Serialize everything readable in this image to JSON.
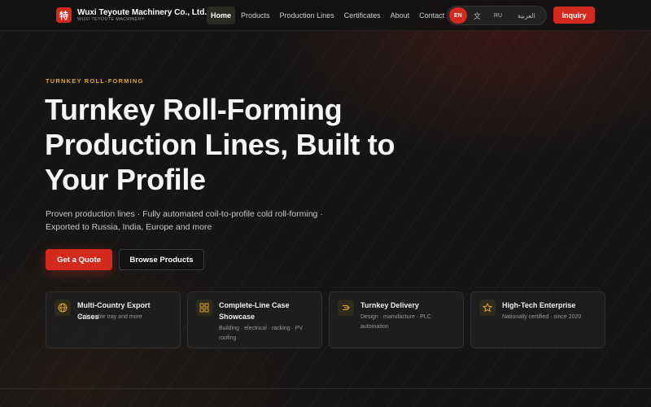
{
  "nav": {
    "logo_glyph": "特",
    "brand_name": "Wuxi Teyoute Machinery Co., Ltd.",
    "brand_sub": "WUXI TEYOUTE MACHINERY",
    "links": [
      {
        "label": "Home",
        "active": true
      },
      {
        "label": "Products"
      },
      {
        "label": "Production Lines"
      },
      {
        "label": "Certificates"
      },
      {
        "label": "About"
      },
      {
        "label": "Contact"
      }
    ],
    "languages": [
      {
        "code": "EN",
        "active": true
      },
      {
        "code": "文"
      },
      {
        "code": "RU"
      },
      {
        "code": "العربية"
      }
    ],
    "inquiry_label": "Inquiry"
  },
  "hero": {
    "eyebrow": "TURNKEY ROLL-FORMING",
    "headline": "Turnkey Roll-Forming Production Lines, Built to Your Profile",
    "subtext": "Proven production lines · Fully automated coil-to-profile cold roll-forming · Exported to Russia, India, Europe and more",
    "primary_cta": "Get a Quote",
    "secondary_cta": "Browse Products"
  },
  "features": [
    {
      "icon": "globe-icon",
      "title": "Multi-Country Export Cases",
      "desc": "Rail / cable tray and more"
    },
    {
      "icon": "grid-icon",
      "title": "Complete-Line Case Showcase",
      "desc": "Building · electrical · racking · PV roofing"
    },
    {
      "icon": "truck-icon",
      "title": "Turnkey Delivery",
      "desc": "Design · manufacture · PLC automation"
    },
    {
      "icon": "star-icon",
      "title": "High-Tech Enterprise",
      "desc": "Nationally certified · since 2020"
    }
  ],
  "colors": {
    "accent": "#d42a1e",
    "eyebrow": "#e0a52a",
    "background": "#151515",
    "icon_color": "#e0a52a"
  }
}
